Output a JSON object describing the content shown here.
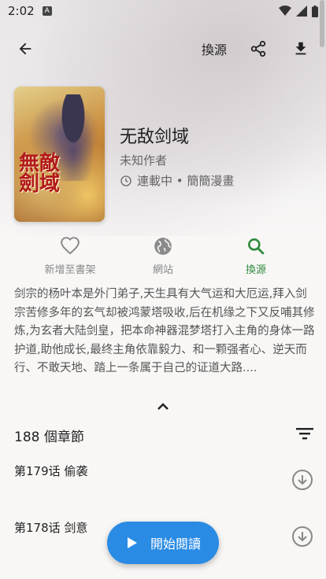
{
  "status_bar": {
    "time": "2:02",
    "notif_badge": "A"
  },
  "app_bar": {
    "switch_source": "換源"
  },
  "manga": {
    "title": "无敌剑域",
    "author": "未知作者",
    "status": "連載中 • 簡簡漫畫",
    "cover_art_text": "無敵劍域"
  },
  "actions": [
    {
      "label": "新增至書架",
      "icon": "heart-outline-icon"
    },
    {
      "label": "網站",
      "icon": "globe-icon"
    },
    {
      "label": "換源",
      "icon": "search-icon"
    }
  ],
  "colors": {
    "accent_green": "#2e8b3e",
    "fab_blue": "#2a8be4"
  },
  "description": "剑宗的杨叶本是外门弟子,天生具有大气运和大厄运,拜入剑宗苦修多年的玄气却被鸿蒙塔吸收,后在机缘之下又反哺其修炼,为玄者大陆剑皇，把本命神器混梦塔打入主角的身体一路护道,助他成长,最终主角依靠毅力、和一颗强者心、逆天而行、不敢天地、踏上一条属于自己的证道大路....",
  "chapters": {
    "count_label": "188 個章節",
    "items": [
      {
        "name": "第179话 偷袭"
      },
      {
        "name": "第178话 剑意"
      }
    ]
  },
  "fab": {
    "label": "開始閱讀"
  }
}
